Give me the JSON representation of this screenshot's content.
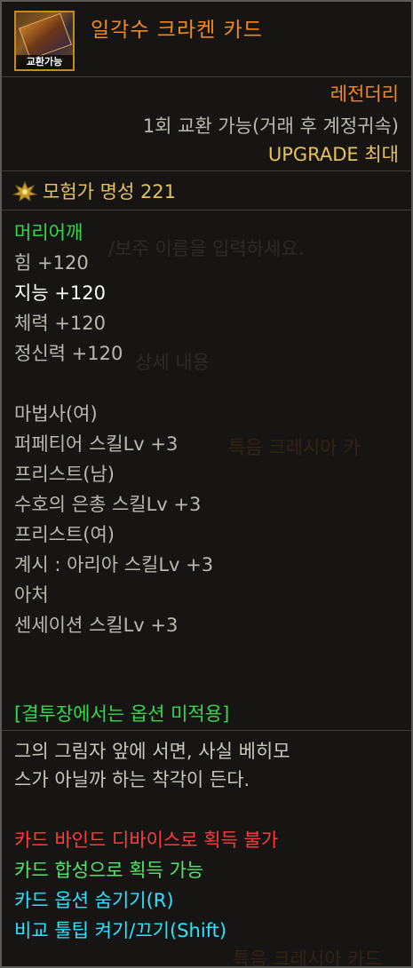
{
  "header": {
    "trade_badge": "교환가능",
    "item_name": "일각수 크라켄 카드",
    "rarity": "레전더리",
    "trade_info": "1회 교환 가능(거래 후 계정귀속)",
    "upgrade": "UPGRADE 최대"
  },
  "fame": {
    "label": "모험가 명성 221"
  },
  "equip": {
    "slot": "머리어깨",
    "stats": [
      {
        "text": "힘 +120",
        "highlight": false
      },
      {
        "text": "지능 +120",
        "highlight": true
      },
      {
        "text": "체력 +120",
        "highlight": false
      },
      {
        "text": "정신력 +120",
        "highlight": false
      }
    ]
  },
  "skills": [
    {
      "class": "마법사(여)",
      "skill": "퍼페티어 스킬Lv +3"
    },
    {
      "class": "프리스트(남)",
      "skill": "수호의 은총 스킬Lv +3"
    },
    {
      "class": "프리스트(여)",
      "skill": "계시 : 아리아 스킬Lv +3"
    },
    {
      "class": "아처",
      "skill": "센세이션 스킬Lv +3"
    }
  ],
  "arena_note": "[결투장에서는 옵션 미적용]",
  "description": "그의 그림자 앞에 서면, 사실 베히모\n스가 아닐까 하는 착각이 든다.",
  "footer": {
    "bind_device": "카드 바인드 디바이스로 획득 불가",
    "synthesis": "카드 합성으로 획득 가능",
    "hide_option": "카드 옵션 숨기기(R)",
    "compare_tooltip": "비교 툴팁 켜기/끄기(Shift)"
  },
  "colors": {
    "name_orange": "#f08a1e",
    "upgrade_gold": "#e7c15a",
    "slot_green": "#35d94a",
    "warning_red": "#ff3b3b",
    "info_cyan": "#2be4ff"
  }
}
